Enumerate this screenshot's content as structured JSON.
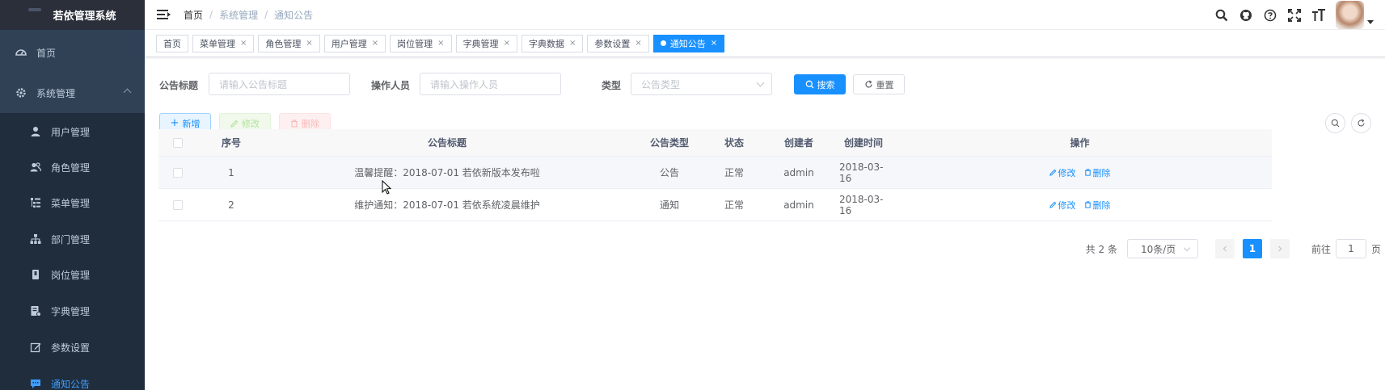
{
  "app": {
    "logo_text": "若依管理系统"
  },
  "sidebar": {
    "items": [
      {
        "label": "首页",
        "icon": "dashboard-icon"
      },
      {
        "label": "系统管理",
        "icon": "gear-icon"
      },
      {
        "label": "用户管理",
        "icon": "user-icon"
      },
      {
        "label": "角色管理",
        "icon": "peoples-icon"
      },
      {
        "label": "菜单管理",
        "icon": "tree-table-icon"
      },
      {
        "label": "部门管理",
        "icon": "tree-icon"
      },
      {
        "label": "岗位管理",
        "icon": "post-icon"
      },
      {
        "label": "字典管理",
        "icon": "dict-icon"
      },
      {
        "label": "参数设置",
        "icon": "edit-icon"
      },
      {
        "label": "通知公告",
        "icon": "message-icon"
      }
    ]
  },
  "navbar": {
    "breadcrumb": [
      "首页",
      "系统管理",
      "通知公告"
    ],
    "separator": "/"
  },
  "tags": [
    {
      "label": "首页",
      "closable": false
    },
    {
      "label": "菜单管理",
      "closable": true
    },
    {
      "label": "角色管理",
      "closable": true
    },
    {
      "label": "用户管理",
      "closable": true
    },
    {
      "label": "岗位管理",
      "closable": true
    },
    {
      "label": "字典管理",
      "closable": true
    },
    {
      "label": "字典数据",
      "closable": true
    },
    {
      "label": "参数设置",
      "closable": true
    },
    {
      "label": "通知公告",
      "closable": true,
      "active": true
    }
  ],
  "close_glyph": "×",
  "search": {
    "title_label": "公告标题",
    "title_placeholder": "请输入公告标题",
    "operator_label": "操作人员",
    "operator_placeholder": "请输入操作人员",
    "type_label": "类型",
    "type_placeholder": "公告类型",
    "search_btn": "搜索",
    "reset_btn": "重置"
  },
  "toolbar": {
    "add": "新增",
    "edit": "修改",
    "delete": "删除"
  },
  "table": {
    "headers": [
      "序号",
      "公告标题",
      "公告类型",
      "状态",
      "创建者",
      "创建时间",
      "操作"
    ],
    "rows": [
      {
        "no": "1",
        "title": "温馨提醒：2018-07-01 若依新版本发布啦",
        "type": "公告",
        "status": "正常",
        "creator": "admin",
        "time": "2018-03-16",
        "edit": "修改",
        "delete": "删除"
      },
      {
        "no": "2",
        "title": "维护通知：2018-07-01 若依系统凌晨维护",
        "type": "通知",
        "status": "正常",
        "creator": "admin",
        "time": "2018-03-16",
        "edit": "修改",
        "delete": "删除"
      }
    ]
  },
  "pagination": {
    "total_text": "共 2 条",
    "page_size": "10条/页",
    "current_page": "1",
    "jump_prefix": "前往",
    "jump_value": "1",
    "jump_suffix": "页"
  },
  "colors": {
    "primary": "#1890ff",
    "sidebar_bg": "#304156",
    "submenu_bg": "#1f2d3d"
  }
}
